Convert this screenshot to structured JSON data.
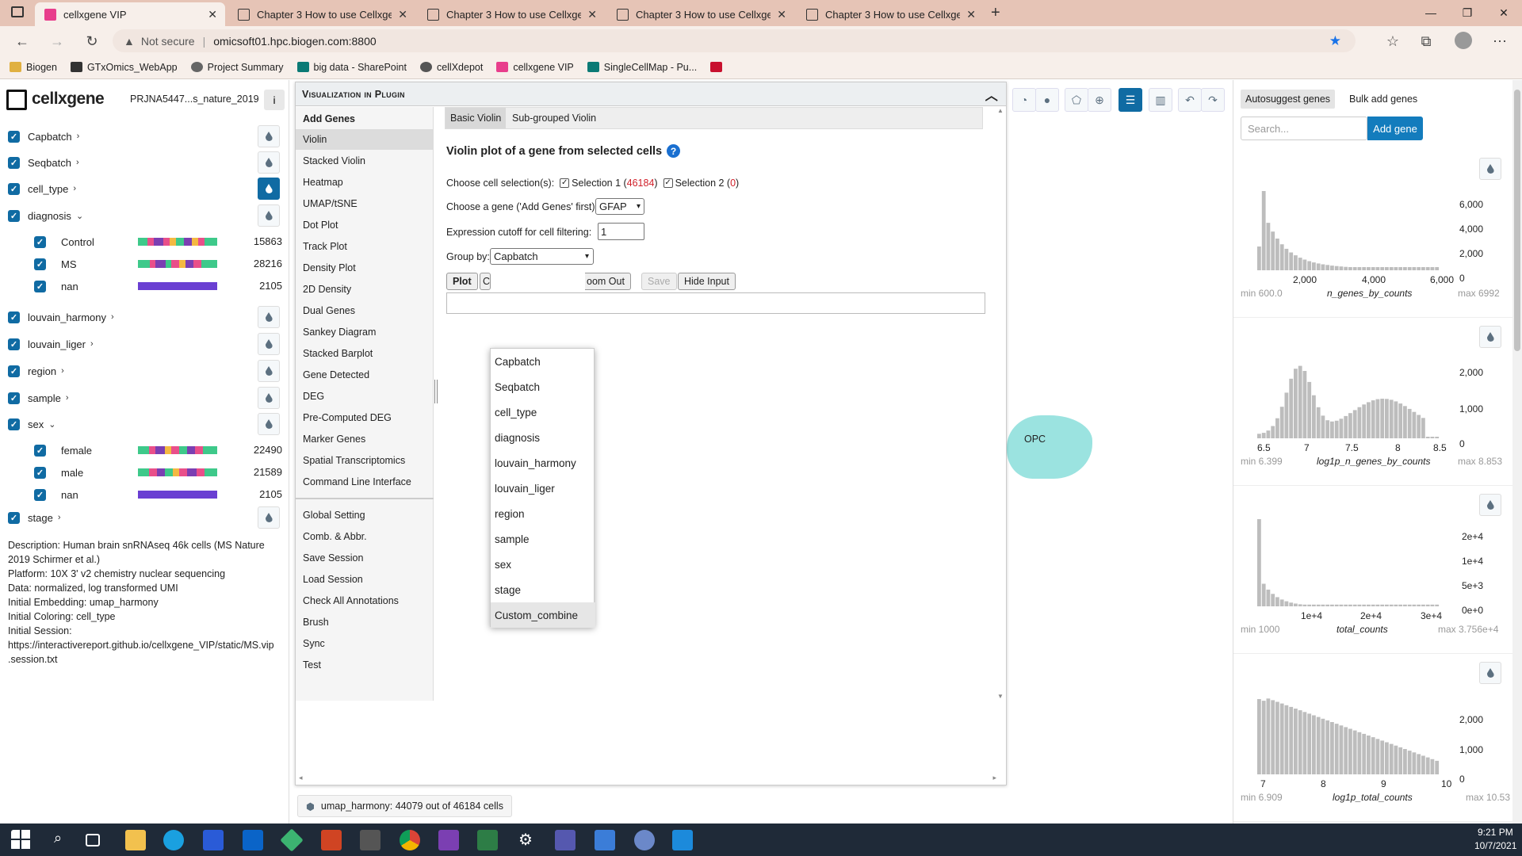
{
  "browser": {
    "tabs": [
      {
        "title": "cellxgene VIP",
        "active": true
      },
      {
        "title": "Chapter 3 How to use Cellxgene",
        "active": false
      },
      {
        "title": "Chapter 3 How to use Cellxgene",
        "active": false
      },
      {
        "title": "Chapter 3 How to use Cellxgene",
        "active": false
      },
      {
        "title": "Chapter 3 How to use Cellxgene",
        "active": false
      }
    ],
    "not_secure": "Not secure",
    "url": "omicsoft01.hpc.biogen.com:8800",
    "bookmarks": [
      "Biogen",
      "GTxOmics_WebApp",
      "Project Summary",
      "big data - SharePoint",
      "cellXdepot",
      "cellxgene VIP",
      "SingleCellMap - Pu..."
    ]
  },
  "app": {
    "logo": "cellxgene",
    "dataset": "PRJNA5447...s_nature_2019"
  },
  "categories": [
    {
      "label": "Capbatch",
      "expanded": false
    },
    {
      "label": "Seqbatch",
      "expanded": false
    },
    {
      "label": "cell_type",
      "expanded": false,
      "active": true
    },
    {
      "label": "diagnosis",
      "expanded": true,
      "values": [
        {
          "label": "Control",
          "count": "15863"
        },
        {
          "label": "MS",
          "count": "28216"
        },
        {
          "label": "nan",
          "count": "2105"
        }
      ]
    },
    {
      "label": "louvain_harmony",
      "expanded": false
    },
    {
      "label": "louvain_liger",
      "expanded": false
    },
    {
      "label": "region",
      "expanded": false
    },
    {
      "label": "sample",
      "expanded": false
    },
    {
      "label": "sex",
      "expanded": true,
      "values": [
        {
          "label": "female",
          "count": "22490"
        },
        {
          "label": "male",
          "count": "21589"
        },
        {
          "label": "nan",
          "count": "2105"
        }
      ]
    },
    {
      "label": "stage",
      "expanded": false
    }
  ],
  "description_lines": [
    "Description: Human brain snRNAseq 46k cells (MS Nature",
    "2019 Schirmer et al.)",
    "Platform: 10X 3' v2 chemistry nuclear sequencing",
    "Data: normalized, log transformed UMI",
    "Initial Embedding: umap_harmony",
    "Initial Coloring: cell_type",
    "Initial Session:",
    "https://interactivereport.github.io/cellxgene_VIP/static/MS.vip",
    ".session.txt"
  ],
  "plugin": {
    "header": "Visualization in Plugin",
    "menu": [
      "Add Genes",
      "Violin",
      "Stacked Violin",
      "Heatmap",
      "UMAP/tSNE",
      "Dot Plot",
      "Track Plot",
      "Density Plot",
      "2D Density",
      "Dual Genes",
      "Sankey Diagram",
      "Stacked Barplot",
      "Gene Detected",
      "DEG",
      "Pre-Computed DEG",
      "Marker Genes",
      "Spatial Transcriptomics",
      "Command Line Interface"
    ],
    "menu2": [
      "Global Setting",
      "Comb. & Abbr.",
      "Save Session",
      "Load Session",
      "Check All Annotations",
      "Brush",
      "Sync",
      "Test"
    ],
    "selected_menu": "Violin",
    "subtabs": [
      "Basic Violin",
      "Sub-grouped Violin"
    ],
    "title": "Violin plot of a gene from selected cells",
    "choose_selection_label": "Choose cell selection(s):",
    "selection1_label": "Selection 1 (",
    "selection1_count": "46184",
    "selection2_label": "Selection 2 (",
    "selection2_count": "0",
    "close_paren": ")",
    "choose_gene_label": "Choose a gene ('Add Genes' first):",
    "gene_value": "GFAP",
    "cutoff_label": "Expression cutoff for cell filtering:",
    "cutoff_value": "1",
    "groupby_label": "Group by:",
    "groupby_value": "Capbatch",
    "buttons": {
      "plot": "Plot",
      "c": "C",
      "zoom_out": "oom Out",
      "save": "Save",
      "hide_input": "Hide Input"
    },
    "groupby_options": [
      "Capbatch",
      "Seqbatch",
      "cell_type",
      "diagnosis",
      "louvain_harmony",
      "louvain_liger",
      "region",
      "sample",
      "sex",
      "stage",
      "Custom_combine"
    ],
    "groupby_highlighted": "Custom_combine"
  },
  "embedding": {
    "cluster_label": "OPC",
    "status": "umap_harmony: 44079 out of 46184 cells",
    "cluster_color": "#9be3e0"
  },
  "right_panel": {
    "tabs": [
      "Autosuggest genes",
      "Bulk add genes"
    ],
    "search_placeholder": "Search...",
    "add_gene": "Add gene",
    "histograms": [
      {
        "name": "n_genes_by_counts",
        "min": "min 600.0",
        "max": "max 6992",
        "yticks": [
          "6,000",
          "4,000",
          "2,000",
          "0"
        ],
        "xticks": [
          "2,000",
          "4,000",
          "6,000"
        ]
      },
      {
        "name": "log1p_n_genes_by_counts",
        "min": "min 6.399",
        "max": "max 8.853",
        "yticks": [
          "2,000",
          "1,000",
          "0"
        ],
        "xticks": [
          "6.5",
          "7",
          "7.5",
          "8",
          "8.5"
        ]
      },
      {
        "name": "total_counts",
        "min": "min 1000",
        "max": "max 3.756e+4",
        "yticks": [
          "2e+4",
          "1e+4",
          "5e+3",
          "0e+0"
        ],
        "xticks": [
          "1e+4",
          "2e+4",
          "3e+4"
        ]
      },
      {
        "name": "log1p_total_counts",
        "min": "min 6.909",
        "max": "max 10.53",
        "yticks": [
          "2,000",
          "1,000",
          "0"
        ],
        "xticks": [
          "7",
          "8",
          "9",
          "10"
        ]
      }
    ]
  },
  "taskbar": {
    "time": "9:21 PM",
    "date": "10/7/2021"
  }
}
